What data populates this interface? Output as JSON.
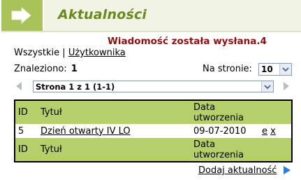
{
  "header": {
    "title": "Aktualności",
    "accent": "#a9c35a",
    "arrow_icon": "arrow-right-icon"
  },
  "message": "Wiadomość została wysłana.4",
  "filters": {
    "all": "Wszystkie",
    "separator": "|",
    "user": "Użytkownika"
  },
  "found": {
    "label": "Znaleziono:",
    "count": "1"
  },
  "per_page": {
    "label": "Na stronie:",
    "value": "10"
  },
  "pager": {
    "value": "Strona 1 z 1 (1-1)"
  },
  "table": {
    "header": {
      "id": "ID",
      "title": "Tytuł",
      "date_line1": "Data",
      "date_line2": "utworzenia"
    },
    "rows": [
      {
        "id": "5",
        "title": "Dzień otwarty IV LO",
        "date": "09-07-2010",
        "edit": "e",
        "delete": "x"
      }
    ],
    "footer": {
      "id": "ID",
      "title": "Tytuł",
      "date_line1": "Data",
      "date_line2": "utworzenia"
    }
  },
  "add_link": "Dodaj aktualność"
}
